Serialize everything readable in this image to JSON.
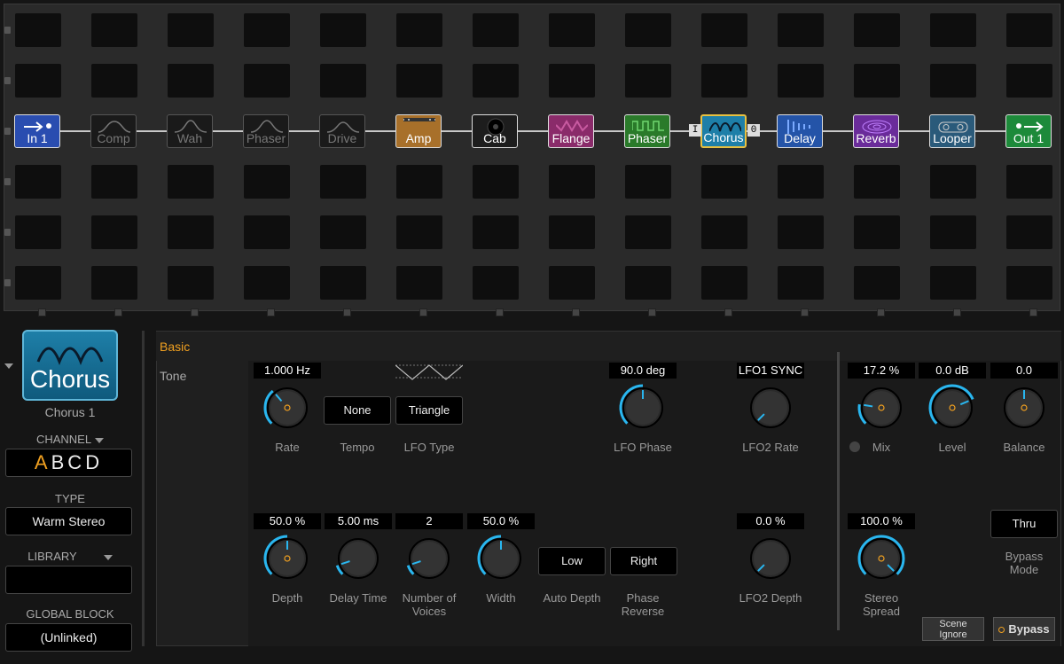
{
  "grid": {
    "blocks": [
      {
        "label": "In 1",
        "icon": "input-icon",
        "color": "#2a4db0"
      },
      {
        "label": "Comp",
        "icon": "comp-icon"
      },
      {
        "label": "Wah",
        "icon": "wah-icon"
      },
      {
        "label": "Phaser",
        "icon": "phaser-shell-icon"
      },
      {
        "label": "Drive",
        "icon": "drive-icon"
      },
      {
        "label": "Amp",
        "icon": "amp-icon",
        "color": "#a8702a"
      },
      {
        "label": "Cab",
        "icon": "cab-icon",
        "color": "#1d1d1d"
      },
      {
        "label": "Flange",
        "icon": "flange-icon",
        "color": "#8a2b6a"
      },
      {
        "label": "Phaser",
        "icon": "phaser-icon",
        "color": "#2a7a2a"
      },
      {
        "label": "Chorus",
        "icon": "chorus-icon",
        "color": "#1e7fa8"
      },
      {
        "label": "Delay",
        "icon": "delay-icon",
        "color": "#2454a8"
      },
      {
        "label": "Reverb",
        "icon": "reverb-icon",
        "color": "#6a2b9a"
      },
      {
        "label": "Looper",
        "icon": "looper-icon",
        "color": "#2a5a7a"
      },
      {
        "label": "Out 1",
        "icon": "output-icon",
        "color": "#1d8a3a"
      }
    ],
    "tag_in": "I",
    "tag_out": "0"
  },
  "left": {
    "block_name": "Chorus",
    "block_instance": "Chorus 1",
    "channel_label": "CHANNEL",
    "channels": [
      "A",
      "B",
      "C",
      "D"
    ],
    "type_label": "TYPE",
    "type_value": "Warm Stereo",
    "library_label": "LIBRARY",
    "library_value": "",
    "global_label": "GLOBAL BLOCK",
    "global_value": "(Unlinked)"
  },
  "tabs": {
    "basic": "Basic",
    "tone": "Tone"
  },
  "params": {
    "rate": {
      "value": "1.000 Hz",
      "label": "Rate"
    },
    "tempo": {
      "value": "None",
      "label": "Tempo"
    },
    "lfo_type": {
      "value": "Triangle",
      "label": "LFO Type"
    },
    "lfo_phase": {
      "value": "90.0 deg",
      "label": "LFO Phase"
    },
    "lfo2_rate": {
      "value": "LFO1 SYNC",
      "label": "LFO2 Rate"
    },
    "mix": {
      "value": "17.2 %",
      "label": "Mix"
    },
    "level": {
      "value": "0.0 dB",
      "label": "Level"
    },
    "balance": {
      "value": "0.0",
      "label": "Balance"
    },
    "depth": {
      "value": "50.0 %",
      "label": "Depth"
    },
    "delay_time": {
      "value": "5.00 ms",
      "label": "Delay Time"
    },
    "voices": {
      "value": "2",
      "label1": "Number of",
      "label2": "Voices"
    },
    "width": {
      "value": "50.0 %",
      "label": "Width"
    },
    "auto_depth": {
      "value": "Low",
      "label": "Auto Depth"
    },
    "phase_reverse": {
      "value": "Right",
      "label1": "Phase",
      "label2": "Reverse"
    },
    "lfo2_depth": {
      "value": "0.0 %",
      "label": "LFO2 Depth"
    },
    "stereo_spread": {
      "value": "100.0 %",
      "label1": "Stereo",
      "label2": "Spread"
    },
    "bypass_mode": {
      "value": "Thru",
      "label1": "Bypass",
      "label2": "Mode"
    }
  },
  "buttons": {
    "scene_ignore_1": "Scene",
    "scene_ignore_2": "Ignore",
    "bypass": "Bypass"
  },
  "colors": {
    "accent": "#f0a020",
    "knob_arc": "#29b6ef"
  }
}
